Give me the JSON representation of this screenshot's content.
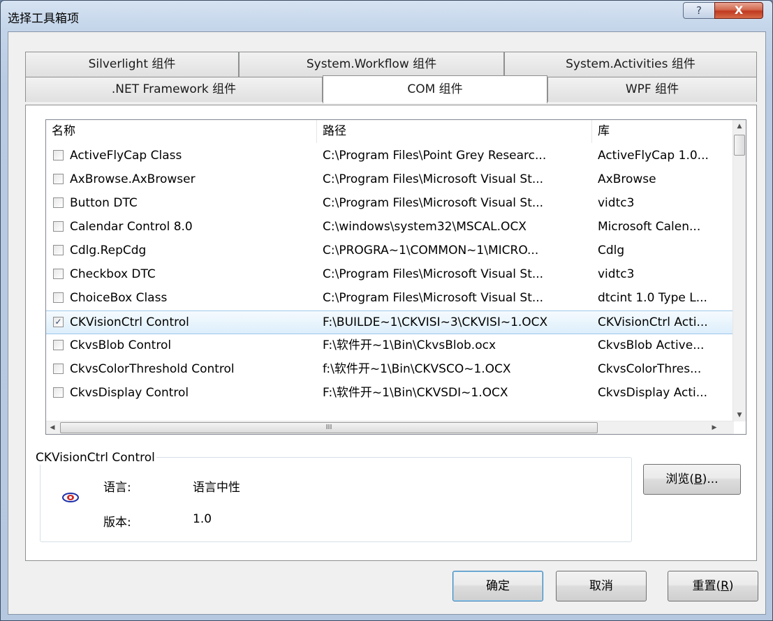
{
  "window": {
    "title": "选择工具箱项",
    "help_glyph": "?",
    "close_glyph": "X"
  },
  "tabs": {
    "row1": [
      "Silverlight 组件",
      "System.Workflow 组件",
      "System.Activities 组件"
    ],
    "row2": [
      ".NET Framework 组件",
      "COM 组件",
      "WPF 组件"
    ],
    "active": "COM 组件"
  },
  "list": {
    "columns": [
      "名称",
      "路径",
      "库"
    ],
    "rows": [
      {
        "name": "ActiveFlyCap Class",
        "path": "C:\\Program Files\\Point Grey Researc...",
        "lib": "ActiveFlyCap 1.0...",
        "checked": false
      },
      {
        "name": "AxBrowse.AxBrowser",
        "path": "C:\\Program Files\\Microsoft Visual St...",
        "lib": "AxBrowse",
        "checked": false
      },
      {
        "name": "Button DTC",
        "path": "C:\\Program Files\\Microsoft Visual St...",
        "lib": "vidtc3",
        "checked": false
      },
      {
        "name": "Calendar Control 8.0",
        "path": "C:\\windows\\system32\\MSCAL.OCX",
        "lib": "Microsoft Calen...",
        "checked": false
      },
      {
        "name": "Cdlg.RepCdg",
        "path": "C:\\PROGRA~1\\COMMON~1\\MICRO...",
        "lib": "Cdlg",
        "checked": false
      },
      {
        "name": "Checkbox DTC",
        "path": "C:\\Program Files\\Microsoft Visual St...",
        "lib": "vidtc3",
        "checked": false
      },
      {
        "name": "ChoiceBox Class",
        "path": "C:\\Program Files\\Microsoft Visual St...",
        "lib": "dtcint 1.0 Type L...",
        "checked": false
      },
      {
        "name": "CKVisionCtrl Control",
        "path": "F:\\BUILDE~1\\CKVISI~3\\CKVISI~1.OCX",
        "lib": "CKVisionCtrl Acti...",
        "checked": true
      },
      {
        "name": "CkvsBlob Control",
        "path": "F:\\软件开~1\\Bin\\CkvsBlob.ocx",
        "lib": "CkvsBlob Active...",
        "checked": false
      },
      {
        "name": "CkvsColorThreshold Control",
        "path": "f:\\软件开~1\\Bin\\CKVSCO~1.OCX",
        "lib": "CkvsColorThres...",
        "checked": false
      },
      {
        "name": "CkvsDisplay Control",
        "path": "F:\\软件开~1\\Bin\\CKVSDI~1.OCX",
        "lib": "CkvsDisplay Acti...",
        "checked": false
      }
    ],
    "hscroll_grip": "III",
    "selected_index": 7
  },
  "details": {
    "title": "CKVisionCtrl Control",
    "language_label": "语言:",
    "language_value": "语言中性",
    "version_label": "版本:",
    "version_value": "1.0",
    "icon": "activex-control-icon"
  },
  "buttons": {
    "browse": "浏览(B)...",
    "browse_main": "浏览(",
    "browse_key": "B",
    "browse_tail": ")...",
    "ok": "确定",
    "cancel": "取消",
    "reset": "重置(R)",
    "reset_main": "重置(",
    "reset_key": "R",
    "reset_tail": ")"
  }
}
